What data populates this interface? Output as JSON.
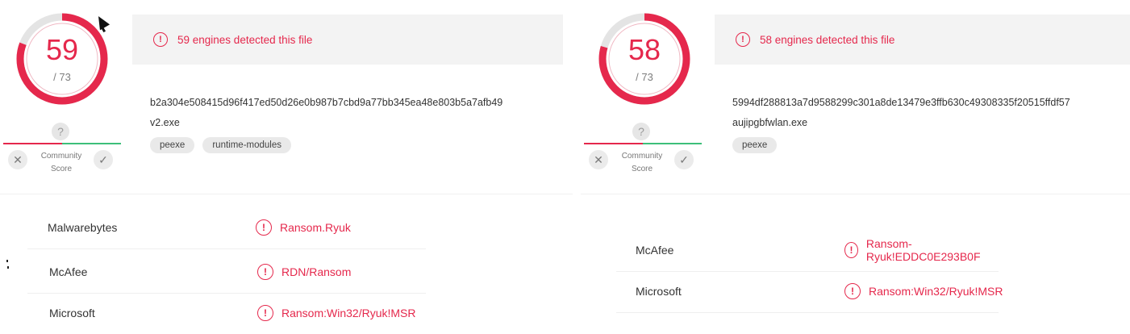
{
  "left": {
    "score": "59",
    "total": "/ 73",
    "score_fraction": 0.808,
    "detection_text": "59 engines detected this file",
    "hash": "b2a304e508415d96f417ed50d26e0b987b7cbd9a77bb345ea48e803b5a7afb49",
    "filename": "v2.exe",
    "tags": [
      "peexe",
      "runtime-modules"
    ],
    "community_label": "Community\nScore",
    "engines": [
      {
        "name": "Malwarebytes",
        "result": "Ransom.Ryuk"
      },
      {
        "name": "McAfee",
        "result": "RDN/Ransom"
      },
      {
        "name": "Microsoft",
        "result": "Ransom:Win32/Ryuk!MSR"
      }
    ]
  },
  "right": {
    "score": "58",
    "total": "/ 73",
    "score_fraction": 0.795,
    "detection_text": "58 engines detected this file",
    "hash": "5994df288813a7d9588299c301a8de13479e3ffb630c49308335f20515ffdf57",
    "filename": "aujipgbfwlan.exe",
    "tags": [
      "peexe"
    ],
    "community_label": "Community\nScore",
    "engines": [
      {
        "name": "McAfee",
        "result": "Ransom-Ryuk!EDDC0E293B0F"
      },
      {
        "name": "Microsoft",
        "result": "Ransom:Win32/Ryuk!MSR"
      }
    ]
  },
  "icons": {
    "alert": "exclamation-circle-icon",
    "question": "question-icon",
    "vote_down": "x-icon",
    "vote_up": "check-icon"
  },
  "colors": {
    "accent": "#e5284c",
    "ring_track": "#e4e4e4",
    "positive": "#3dbf7a"
  }
}
